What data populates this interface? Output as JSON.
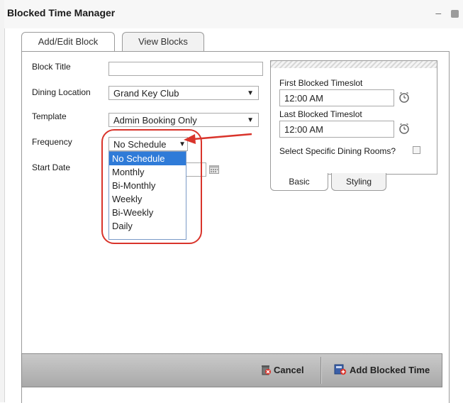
{
  "window": {
    "title": "Blocked Time Manager"
  },
  "tabs": [
    {
      "label": "Add/Edit Block",
      "active": true
    },
    {
      "label": "View Blocks",
      "active": false
    }
  ],
  "form": {
    "block_title": {
      "label": "Block Title",
      "value": ""
    },
    "dining_location": {
      "label": "Dining Location",
      "value": "Grand Key Club"
    },
    "template": {
      "label": "Template",
      "value": "Admin Booking Only"
    },
    "frequency": {
      "label": "Frequency",
      "value": "No Schedule",
      "options": [
        "No Schedule",
        "Monthly",
        "Bi-Monthly",
        "Weekly",
        "Bi-Weekly",
        "Daily"
      ],
      "selected_index": 0
    },
    "start_date": {
      "label": "Start Date",
      "value": ""
    }
  },
  "side_panel": {
    "first_timeslot": {
      "label": "First Blocked Timeslot",
      "value": "12:00 AM"
    },
    "last_timeslot": {
      "label": "Last Blocked Timeslot",
      "value": "12:00 AM"
    },
    "select_rooms": {
      "label": "Select Specific Dining Rooms?",
      "checked": false
    },
    "subtabs": [
      {
        "label": "Basic",
        "active": true
      },
      {
        "label": "Styling",
        "active": false
      }
    ]
  },
  "footer": {
    "cancel_label": "Cancel",
    "add_label": "Add Blocked Time"
  },
  "colors": {
    "accent_blue": "#2f7bd8",
    "annotation_red": "#d9342b"
  }
}
